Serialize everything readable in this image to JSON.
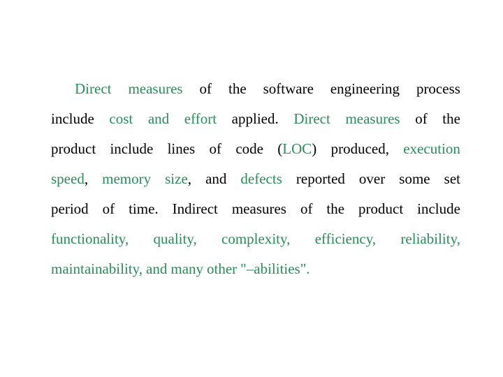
{
  "accent_color": "#2a8c5a",
  "paragraph": {
    "lines": [
      [
        {
          "t": "Direct",
          "hl": true
        },
        {
          "t": "measures",
          "hl": true
        },
        {
          "t": "of"
        },
        {
          "t": "the"
        },
        {
          "t": "software"
        },
        {
          "t": "engineering"
        },
        {
          "t": "process"
        }
      ],
      [
        {
          "t": "include"
        },
        {
          "t": "cost",
          "hl": true
        },
        {
          "t": "and",
          "hl": true
        },
        {
          "t": "effort",
          "hl": true
        },
        {
          "t": "applied."
        },
        {
          "t": "Direct",
          "hl": true
        },
        {
          "t": "measures",
          "hl": true
        },
        {
          "t": "of"
        },
        {
          "t": "the"
        }
      ],
      [
        {
          "t": "product"
        },
        {
          "t": "include"
        },
        {
          "t": "lines"
        },
        {
          "t": "of"
        },
        {
          "t": "code"
        },
        {
          "parts": [
            {
              "t": "("
            },
            {
              "t": "LOC",
              "hl": true
            },
            {
              "t": ")"
            }
          ]
        },
        {
          "t": "produced,"
        },
        {
          "t": "execution",
          "hl": true
        }
      ],
      [
        {
          "parts": [
            {
              "t": "speed",
              "hl": true
            },
            {
              "t": ","
            }
          ]
        },
        {
          "t": "memory",
          "hl": true
        },
        {
          "parts": [
            {
              "t": "size",
              "hl": true
            },
            {
              "t": ","
            }
          ]
        },
        {
          "t": "and"
        },
        {
          "t": "defects",
          "hl": true
        },
        {
          "t": "reported"
        },
        {
          "t": "over"
        },
        {
          "t": "some"
        },
        {
          "t": "set"
        }
      ],
      [
        {
          "t": "period"
        },
        {
          "t": "of"
        },
        {
          "t": "time."
        },
        {
          "t": "Indirect"
        },
        {
          "t": "measures"
        },
        {
          "t": "of"
        },
        {
          "t": "the"
        },
        {
          "t": "product"
        },
        {
          "t": "include"
        }
      ],
      [
        {
          "t": "functionality,",
          "hl": true
        },
        {
          "t": "quality,",
          "hl": true
        },
        {
          "t": "complexity,",
          "hl": true
        },
        {
          "t": "efficiency,",
          "hl": true
        },
        {
          "t": "reliability,",
          "hl": true
        }
      ],
      [
        {
          "t": "maintainability,",
          "hl": true
        },
        {
          "t": "and",
          "hl": true
        },
        {
          "t": "many",
          "hl": true
        },
        {
          "t": "other",
          "hl": true
        },
        {
          "t": "\"–abilities\".",
          "hl": true
        }
      ]
    ]
  }
}
